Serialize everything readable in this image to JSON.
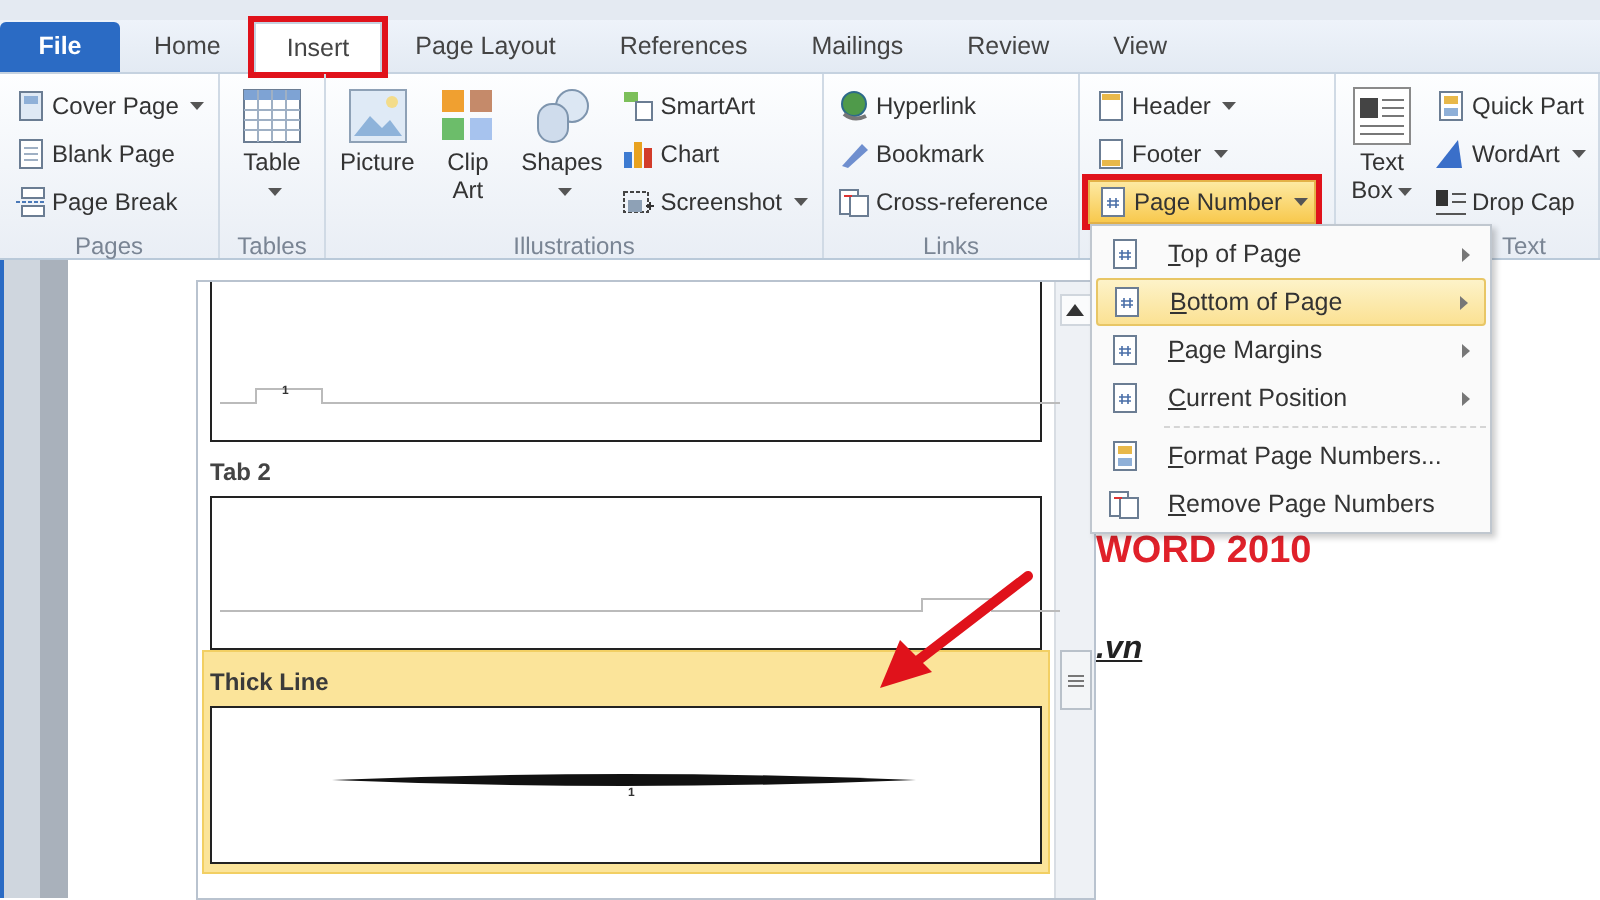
{
  "tabs": [
    {
      "label": "File",
      "kind": "file",
      "selected": false,
      "annotated": false
    },
    {
      "label": "Home",
      "kind": "tab",
      "selected": false,
      "annotated": false
    },
    {
      "label": "Insert",
      "kind": "tab",
      "selected": true,
      "annotated": true
    },
    {
      "label": "Page Layout",
      "kind": "tab",
      "selected": false,
      "annotated": false
    },
    {
      "label": "References",
      "kind": "tab",
      "selected": false,
      "annotated": false
    },
    {
      "label": "Mailings",
      "kind": "tab",
      "selected": false,
      "annotated": false
    },
    {
      "label": "Review",
      "kind": "tab",
      "selected": false,
      "annotated": false
    },
    {
      "label": "View",
      "kind": "tab",
      "selected": false,
      "annotated": false
    }
  ],
  "ribbon": {
    "groups": [
      {
        "label": "Pages",
        "columns": [
          {
            "kind": "small",
            "items": [
              {
                "label": "Cover Page",
                "dropdown": true,
                "active": false,
                "annotated": false
              },
              {
                "label": "Blank Page",
                "dropdown": false,
                "active": false,
                "annotated": false
              },
              {
                "label": "Page Break",
                "dropdown": false,
                "active": false,
                "annotated": false
              }
            ]
          }
        ]
      },
      {
        "label": "Tables",
        "columns": [
          {
            "kind": "large",
            "items": [
              {
                "label": "Table",
                "dropdown": true,
                "active": false,
                "annotated": false
              }
            ]
          }
        ]
      },
      {
        "label": "Illustrations",
        "columns": [
          {
            "kind": "large",
            "items": [
              {
                "label": "Picture",
                "dropdown": false,
                "active": false,
                "annotated": false
              },
              {
                "label": "Clip Art",
                "dropdown": false,
                "active": false,
                "annotated": false
              },
              {
                "label": "Shapes",
                "dropdown": true,
                "active": false,
                "annotated": false
              }
            ]
          },
          {
            "kind": "small",
            "items": [
              {
                "label": "SmartArt",
                "dropdown": false,
                "active": false,
                "annotated": false
              },
              {
                "label": "Chart",
                "dropdown": false,
                "active": false,
                "annotated": false
              },
              {
                "label": "Screenshot",
                "dropdown": true,
                "active": false,
                "annotated": false
              }
            ]
          }
        ]
      },
      {
        "label": "Links",
        "columns": [
          {
            "kind": "small",
            "items": [
              {
                "label": "Hyperlink",
                "dropdown": false,
                "active": false,
                "annotated": false
              },
              {
                "label": "Bookmark",
                "dropdown": false,
                "active": false,
                "annotated": false
              },
              {
                "label": "Cross-reference",
                "dropdown": false,
                "active": false,
                "annotated": false
              }
            ]
          }
        ]
      },
      {
        "columns": [
          {
            "kind": "small",
            "items": [
              {
                "label": "Header",
                "dropdown": true,
                "active": false,
                "annotated": false
              },
              {
                "label": "Footer",
                "dropdown": true,
                "active": false,
                "annotated": false
              },
              {
                "label": "Page Number",
                "dropdown": true,
                "active": true,
                "annotated": true
              }
            ]
          }
        ]
      },
      {
        "label": "Text",
        "columns": [
          {
            "kind": "large",
            "items": [
              {
                "label": "Text Box",
                "dropdown": true,
                "active": false,
                "annotated": false
              }
            ]
          },
          {
            "kind": "small",
            "items": [
              {
                "label": "Quick Part",
                "dropdown": false,
                "active": false,
                "annotated": false
              },
              {
                "label": "WordArt",
                "dropdown": true,
                "active": false,
                "annotated": false
              },
              {
                "label": "Drop Cap",
                "dropdown": false,
                "active": false,
                "annotated": false
              }
            ]
          }
        ]
      }
    ]
  },
  "document": {
    "heading": "WORD 2010",
    "line": ".vn"
  },
  "gallery": {
    "items": [
      {
        "kind": "tab",
        "number": "1",
        "selected": false
      },
      {
        "kind": "tab-right",
        "title": "Tab 2",
        "selected": false
      },
      {
        "kind": "thick-line",
        "title": "Thick Line",
        "number": "1",
        "selected": true
      }
    ]
  },
  "menu": {
    "items": [
      {
        "label": "Top of Page",
        "submenu": true,
        "selected": false
      },
      {
        "label": "Bottom of Page",
        "submenu": true,
        "selected": true
      },
      {
        "label": "Page Margins",
        "submenu": true,
        "selected": false
      },
      {
        "label": "Current Position",
        "submenu": true,
        "selected": false
      },
      {
        "label": "Format Page Numbers...",
        "submenu": false,
        "selected": false
      },
      {
        "label": "Remove Page Numbers",
        "submenu": false,
        "selected": false
      }
    ]
  }
}
